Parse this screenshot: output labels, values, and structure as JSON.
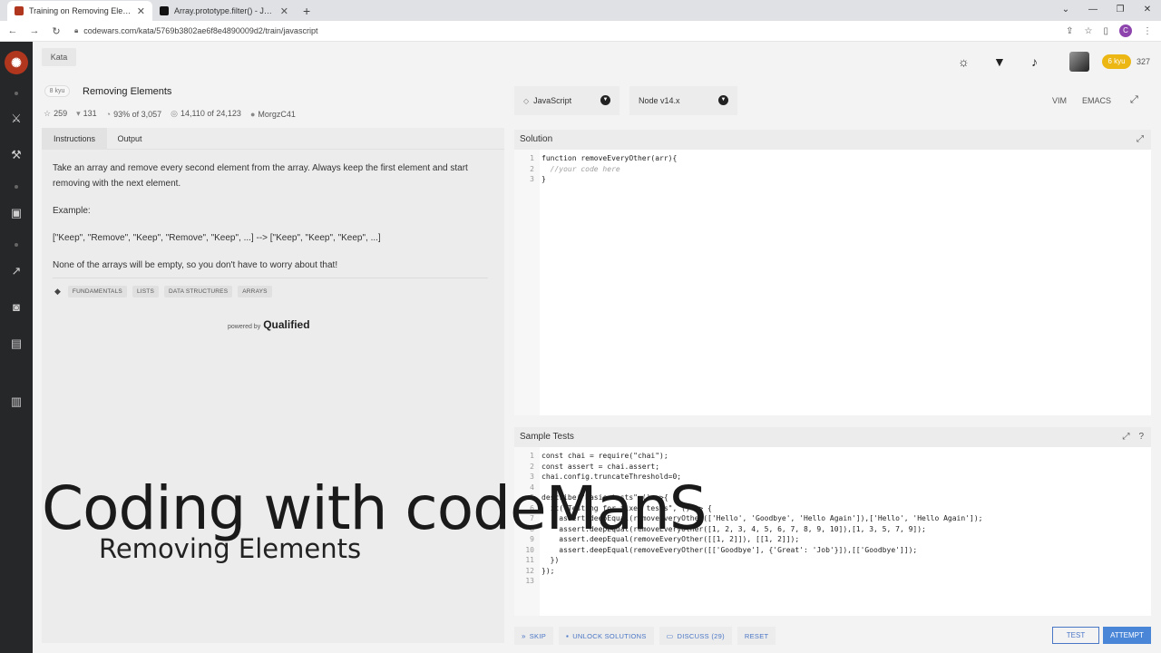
{
  "browser": {
    "tabs": [
      {
        "label": "Training on Removing Elements | Codewars",
        "active": true
      },
      {
        "label": "Array.prototype.filter() - JavaScript | MDN",
        "active": false
      }
    ],
    "url": "codewars.com/kata/5769b3802ae6f8e4890009d2/train/javascript",
    "profile_initial": "C"
  },
  "header": {
    "kata_tab": "Kata",
    "rank_badge": "6 kyu",
    "honor": "327"
  },
  "kata": {
    "kyu": "8 kyu",
    "title": "Removing Elements",
    "stats": {
      "stars": "259",
      "favorites": "131",
      "satisfaction": "93%",
      "votes": "of 3,057",
      "completed": "14,110",
      "total": "of 24,123",
      "author": "MorgzC41"
    }
  },
  "left_panel": {
    "tabs": [
      "Instructions",
      "Output"
    ],
    "paragraphs": [
      "Take an array and remove every second element from the array. Always keep the first element and start removing with the next element.",
      "Example:",
      "[\"Keep\", \"Remove\", \"Keep\", \"Remove\", \"Keep\", ...] --> [\"Keep\", \"Keep\", \"Keep\", ...]",
      "None of the arrays will be empty, so you don't have to worry about that!"
    ],
    "tags": [
      "FUNDAMENTALS",
      "LISTS",
      "DATA STRUCTURES",
      "ARRAYS"
    ],
    "powered_by": "powered by",
    "powered_brand": "Qualified"
  },
  "overlay": {
    "main": "Coding with codeManS",
    "sub": "Removing Elements"
  },
  "editor_options": {
    "language": "JavaScript",
    "version": "Node v14.x",
    "vim": "VIM",
    "emacs": "EMACS"
  },
  "solution": {
    "title": "Solution",
    "lines": [
      "function removeEveryOther(arr){",
      "  //your code here",
      "}"
    ]
  },
  "sample_tests": {
    "title": "Sample Tests",
    "lines": [
      "const chai = require(\"chai\");",
      "const assert = chai.assert;",
      "chai.config.truncateThreshold=0;",
      "",
      "describe(\"Basic tests\",() =>{",
      "  it(\"Testing for fixed tests\", () => {",
      "    assert.deepEqual(removeEveryOther(['Hello', 'Goodbye', 'Hello Again']),['Hello', 'Hello Again']);",
      "    assert.deepEqual(removeEveryOther([1, 2, 3, 4, 5, 6, 7, 8, 9, 10]),[1, 3, 5, 7, 9]);",
      "    assert.deepEqual(removeEveryOther([[1, 2]]), [[1, 2]]);",
      "    assert.deepEqual(removeEveryOther([['Goodbye'], {'Great': 'Job'}]),[['Goodbye']]);",
      "  })",
      "});",
      ""
    ]
  },
  "bottom": {
    "skip": "SKIP",
    "unlock": "UNLOCK SOLUTIONS",
    "discuss": "DISCUSS (29)",
    "reset": "RESET",
    "test": "TEST",
    "attempt": "ATTEMPT"
  },
  "colors": {
    "accent": "#4a76c6",
    "brand_red": "#b1361e",
    "rank_yellow": "#ecb613"
  }
}
